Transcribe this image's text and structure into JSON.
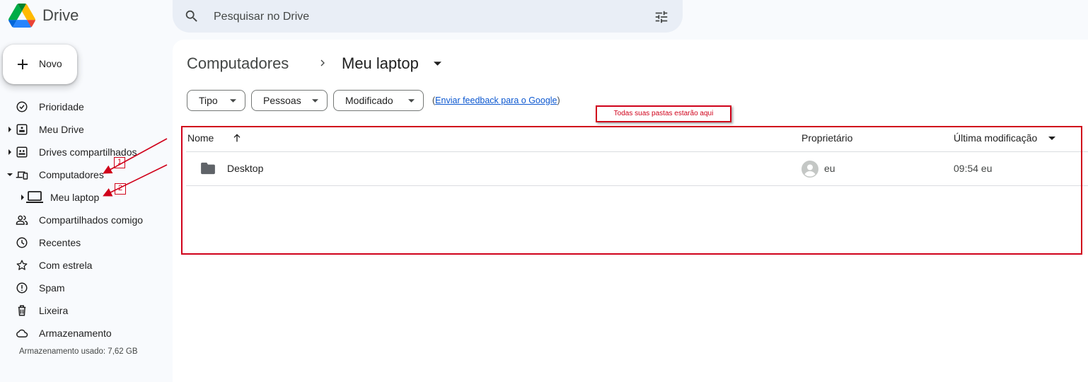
{
  "app": {
    "title": "Drive"
  },
  "search": {
    "placeholder": "Pesquisar no Drive"
  },
  "new_button": {
    "label": "Novo"
  },
  "sidebar": {
    "items": [
      {
        "label": "Prioridade",
        "icon": "priority-icon"
      },
      {
        "label": "Meu Drive",
        "icon": "my-drive-icon"
      },
      {
        "label": "Drives compartilhados",
        "icon": "shared-drives-icon"
      },
      {
        "label": "Computadores",
        "icon": "computers-icon"
      },
      {
        "label": "Meu laptop",
        "icon": "laptop-icon"
      },
      {
        "label": "Compartilhados comigo",
        "icon": "shared-with-me-icon"
      },
      {
        "label": "Recentes",
        "icon": "clock-icon"
      },
      {
        "label": "Com estrela",
        "icon": "star-icon"
      },
      {
        "label": "Spam",
        "icon": "spam-icon"
      },
      {
        "label": "Lixeira",
        "icon": "trash-icon"
      },
      {
        "label": "Armazenamento",
        "icon": "cloud-icon"
      }
    ],
    "storage_used": "Armazenamento usado: 7,62 GB"
  },
  "breadcrumb": {
    "parent": "Computadores",
    "current": "Meu laptop"
  },
  "filters": [
    {
      "label": "Tipo"
    },
    {
      "label": "Pessoas"
    },
    {
      "label": "Modificado"
    }
  ],
  "feedback": {
    "prefix": "(",
    "link": "Enviar feedback para o Google",
    "suffix": ")"
  },
  "table": {
    "columns": {
      "name": "Nome",
      "owner": "Proprietário",
      "modified": "Última modificação"
    },
    "rows": [
      {
        "name": "Desktop",
        "owner": "eu",
        "modified": "09:54 eu"
      }
    ]
  },
  "annotations": {
    "label": "Todas suas pastas estarão aqui",
    "marker_1": "1",
    "marker_2": "2",
    "color": "#d0021b"
  },
  "colors": {
    "background": "#f8fafd",
    "search_bg": "#e9eef6",
    "link": "#0b57d0",
    "text": "#1f1f1f"
  }
}
